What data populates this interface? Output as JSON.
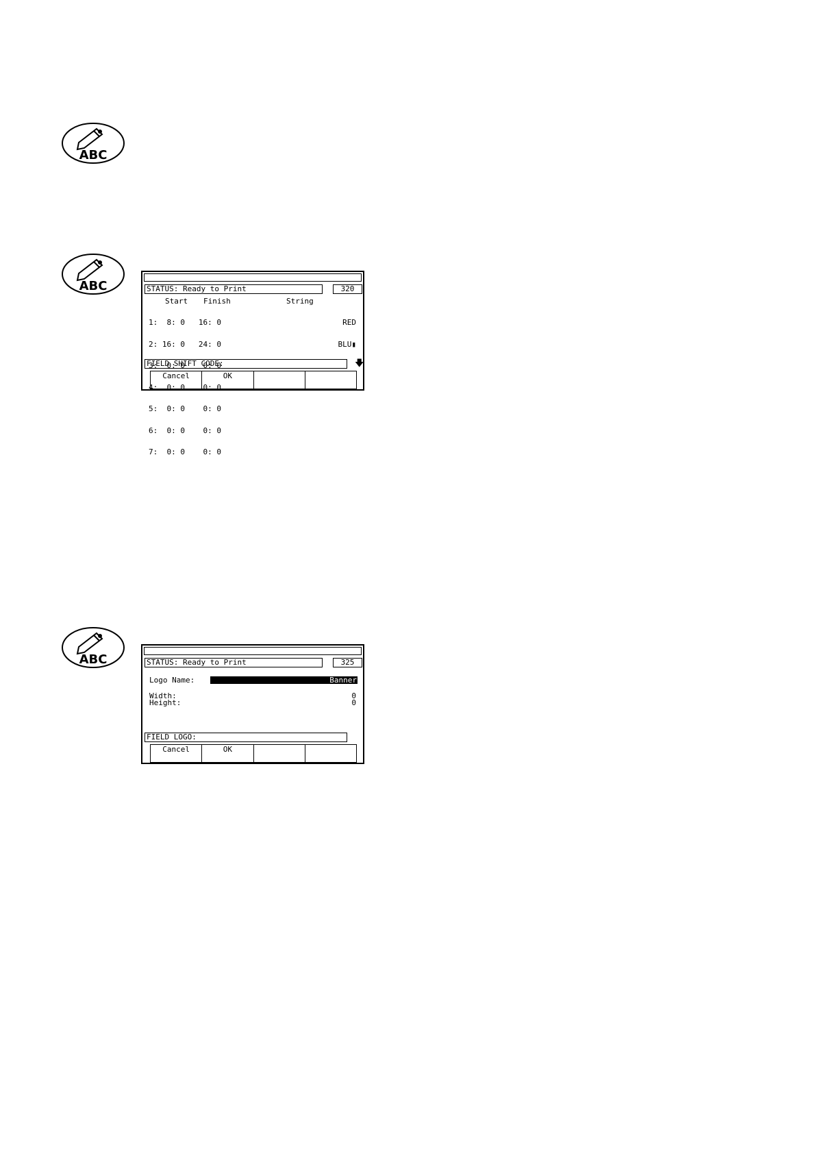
{
  "screen320": {
    "status": "STATUS: Ready to Print",
    "number": "320",
    "headers": {
      "start": "Start",
      "finish": "Finish",
      "string": "String"
    },
    "rows": [
      {
        "n": "1:",
        "start": " 8: 0",
        "finish": "16: 0",
        "string": "RED"
      },
      {
        "n": "2:",
        "start": "16: 0",
        "finish": "24: 0",
        "string": "BLU▮"
      },
      {
        "n": "3:",
        "start": " 0: 0",
        "finish": " 0: 0",
        "string": ""
      },
      {
        "n": "4:",
        "start": " 0: 0",
        "finish": " 0: 0",
        "string": ""
      },
      {
        "n": "5:",
        "start": " 0: 0",
        "finish": " 0: 0",
        "string": ""
      },
      {
        "n": "6:",
        "start": " 0: 0",
        "finish": " 0: 0",
        "string": ""
      },
      {
        "n": "7:",
        "start": " 0: 0",
        "finish": " 0: 0",
        "string": ""
      }
    ],
    "field": "FIELD SHIFT CODE:",
    "softkeys": [
      "Cancel",
      "OK",
      "",
      ""
    ]
  },
  "screen325": {
    "status": "STATUS: Ready to Print",
    "number": "325",
    "logo_name_label": "Logo Name:",
    "logo_name_value": "Banner",
    "width_label": "Width:",
    "width_value": "0",
    "height_label": "Height:",
    "height_value": "0",
    "field": "FIELD LOGO:",
    "softkeys": [
      "Cancel",
      "OK",
      "",
      ""
    ]
  },
  "icon_text": "ABC"
}
